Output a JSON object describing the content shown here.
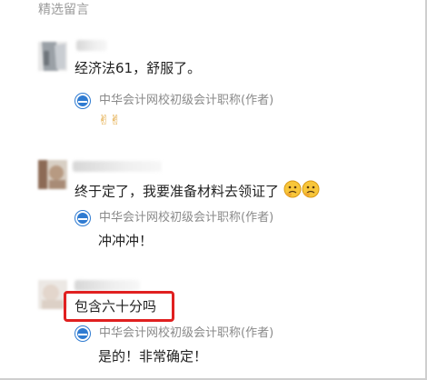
{
  "section_title": "精选留言",
  "comments": [
    {
      "text": "经济法61，舒服了。",
      "reply_author": "中华会计网校初级会计职称(作者)",
      "reply_text": "✌✌"
    },
    {
      "text": "终于定了，我要准备材料去领证了",
      "reply_author": "中华会计网校初级会计职称(作者)",
      "reply_text": "冲冲冲！"
    },
    {
      "text": "包含六十分吗",
      "reply_author": "中华会计网校初级会计职称(作者)",
      "reply_text": "是的！非常确定！"
    }
  ],
  "colors": {
    "highlight": "#e02020",
    "brand_blue": "#2f7bd1",
    "muted_text": "#8a8a8a"
  }
}
